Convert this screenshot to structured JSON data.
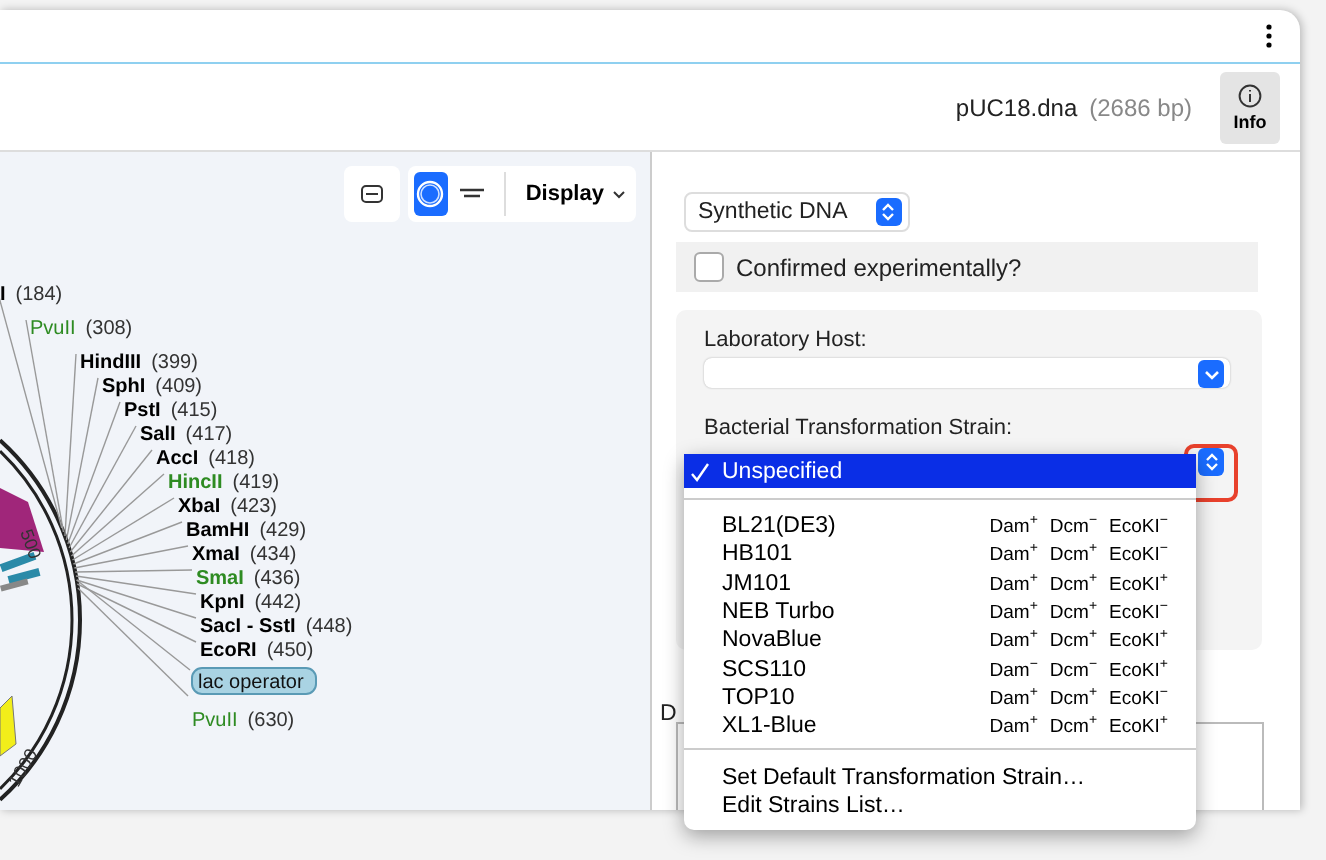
{
  "document": {
    "filename": "pUC18.dna",
    "length": "(2686 bp)"
  },
  "info_button": {
    "label": "Info"
  },
  "map_toolbar": {
    "views": [
      {
        "kind": "circular",
        "selected": true
      },
      {
        "kind": "linear",
        "selected": false
      }
    ],
    "display_button": "Display"
  },
  "map": {
    "enzymes": [
      {
        "name": "I",
        "position": "(184)",
        "color": "#000000",
        "bold": true
      },
      {
        "name": "PvuII",
        "position": "(308)",
        "color": "#2e8b22",
        "bold": false
      },
      {
        "name": "HindIII",
        "position": "(399)",
        "color": "#000000",
        "bold": true
      },
      {
        "name": "SphI",
        "position": "(409)",
        "color": "#000000",
        "bold": true
      },
      {
        "name": "PstI",
        "position": "(415)",
        "color": "#000000",
        "bold": true
      },
      {
        "name": "SalI",
        "position": "(417)",
        "color": "#000000",
        "bold": true
      },
      {
        "name": "AccI",
        "position": "(418)",
        "color": "#000000",
        "bold": true
      },
      {
        "name": "HincII",
        "position": "(419)",
        "color": "#2e8b22",
        "bold": true
      },
      {
        "name": "XbaI",
        "position": "(423)",
        "color": "#000000",
        "bold": true
      },
      {
        "name": "BamHI",
        "position": "(429)",
        "color": "#000000",
        "bold": true
      },
      {
        "name": "XmaI",
        "position": "(434)",
        "color": "#000000",
        "bold": true
      },
      {
        "name": "SmaI",
        "position": "(436)",
        "color": "#2e8b22",
        "bold": true
      },
      {
        "name": "KpnI",
        "position": "(442)",
        "color": "#000000",
        "bold": true
      },
      {
        "name": "SacI - SstI",
        "position": "(448)",
        "color": "#000000",
        "bold": true
      },
      {
        "name": "EcoRI",
        "position": "(450)",
        "color": "#000000",
        "bold": true
      },
      {
        "name": "PvuII",
        "position": "(630)",
        "color": "#2e8b22",
        "bold": false
      }
    ],
    "features": [
      {
        "label": "lac operator"
      }
    ],
    "ticks": [
      "500",
      "1000"
    ]
  },
  "molecule_type": {
    "value": "Synthetic DNA"
  },
  "confirmed": {
    "label": "Confirmed experimentally?",
    "checked": false
  },
  "host": {
    "label": "Laboratory Host:"
  },
  "strain": {
    "label": "Bacterial Transformation Strain:"
  },
  "strain_menu": {
    "items": [
      {
        "name": "Unspecified",
        "selected": true
      },
      {
        "name": "BL21(DE3)",
        "selected": false,
        "markers": [
          "Dam$^{+}$",
          "Dcm$^{−}$",
          "EcoKI$^{−}$"
        ]
      },
      {
        "name": "HB101",
        "selected": false,
        "markers": [
          "Dam$^{+}$",
          "Dcm$^{+}$",
          "EcoKI$^{−}$"
        ]
      },
      {
        "name": "JM101",
        "selected": false,
        "markers": [
          "Dam$^{+}$",
          "Dcm$^{+}$",
          "EcoKI$^{+}$"
        ]
      },
      {
        "name": "NEB Turbo",
        "selected": false,
        "markers": [
          "Dam$^{+}$",
          "Dcm$^{+}$",
          "EcoKI$^{−}$"
        ]
      },
      {
        "name": "NovaBlue",
        "selected": false,
        "markers": [
          "Dam$^{+}$",
          "Dcm$^{+}$",
          "EcoKI$^{+}$"
        ]
      },
      {
        "name": "SCS110",
        "selected": false,
        "markers": [
          "Dam$^{−}$",
          "Dcm$^{−}$",
          "EcoKI$^{+}$"
        ]
      },
      {
        "name": "TOP10",
        "selected": false,
        "markers": [
          "Dam$^{+}$",
          "Dcm$^{+}$",
          "EcoKI$^{−}$"
        ]
      },
      {
        "name": "XL1-Blue",
        "selected": false,
        "markers": [
          "Dam$^{+}$",
          "Dcm$^{+}$",
          "EcoKI$^{+}$"
        ]
      }
    ],
    "actions": [
      "Set Default Transformation Strain…",
      "Edit Strains List…"
    ]
  },
  "section_label": "D"
}
